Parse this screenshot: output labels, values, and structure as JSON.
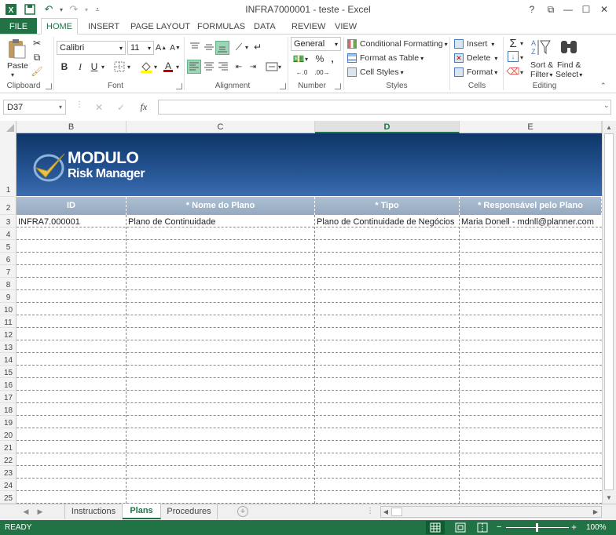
{
  "window": {
    "title": "INFRA7000001 - teste - Excel",
    "controls": [
      "?",
      "⧉",
      "—",
      "☐",
      "✕"
    ]
  },
  "ribbon_tabs": {
    "file": "FILE",
    "items": [
      "HOME",
      "INSERT",
      "PAGE LAYOUT",
      "FORMULAS",
      "DATA",
      "REVIEW",
      "VIEW"
    ],
    "active": "HOME"
  },
  "ribbon": {
    "clipboard": {
      "label": "Clipboard",
      "paste": "Paste"
    },
    "font": {
      "label": "Font",
      "name": "Calibri",
      "size": "11"
    },
    "alignment": {
      "label": "Alignment"
    },
    "number": {
      "label": "Number",
      "format": "General"
    },
    "styles": {
      "label": "Styles",
      "conditional": "Conditional Formatting",
      "format_table": "Format as Table",
      "cell_styles": "Cell Styles"
    },
    "cells": {
      "label": "Cells",
      "insert": "Insert",
      "delete": "Delete",
      "format": "Format"
    },
    "editing": {
      "label": "Editing",
      "sort": "Sort &",
      "filter": "Filter",
      "find": "Find &",
      "select": "Select"
    }
  },
  "formula_bar": {
    "name_box": "D37",
    "fx": "fx",
    "value": ""
  },
  "sheet": {
    "columns": [
      {
        "id": "B",
        "header": "ID",
        "row3": "INFRA7.000001"
      },
      {
        "id": "C",
        "header": "* Nome do Plano",
        "row3": "Plano de Continuidade"
      },
      {
        "id": "D",
        "header": "* Tipo",
        "row3": "Plano de Continuidade de Negócios"
      },
      {
        "id": "E",
        "header": "* Responsável pelo Plano",
        "row3": "Maria Donell - mdnll@planner.com"
      }
    ],
    "selected_column": "D",
    "rows": [
      "1",
      "2",
      "3",
      "4",
      "5",
      "6",
      "7",
      "8",
      "9",
      "10",
      "11",
      "12",
      "13",
      "14",
      "15",
      "16",
      "17",
      "18",
      "19",
      "20",
      "21",
      "22",
      "23",
      "24",
      "25"
    ],
    "banner": {
      "line1": "MODULO",
      "line2": "Risk Manager"
    }
  },
  "sheet_tabs": {
    "items": [
      "Instructions",
      "Plans",
      "Procedures"
    ],
    "active": "Plans"
  },
  "status": {
    "text": "READY",
    "zoom": "100%"
  }
}
